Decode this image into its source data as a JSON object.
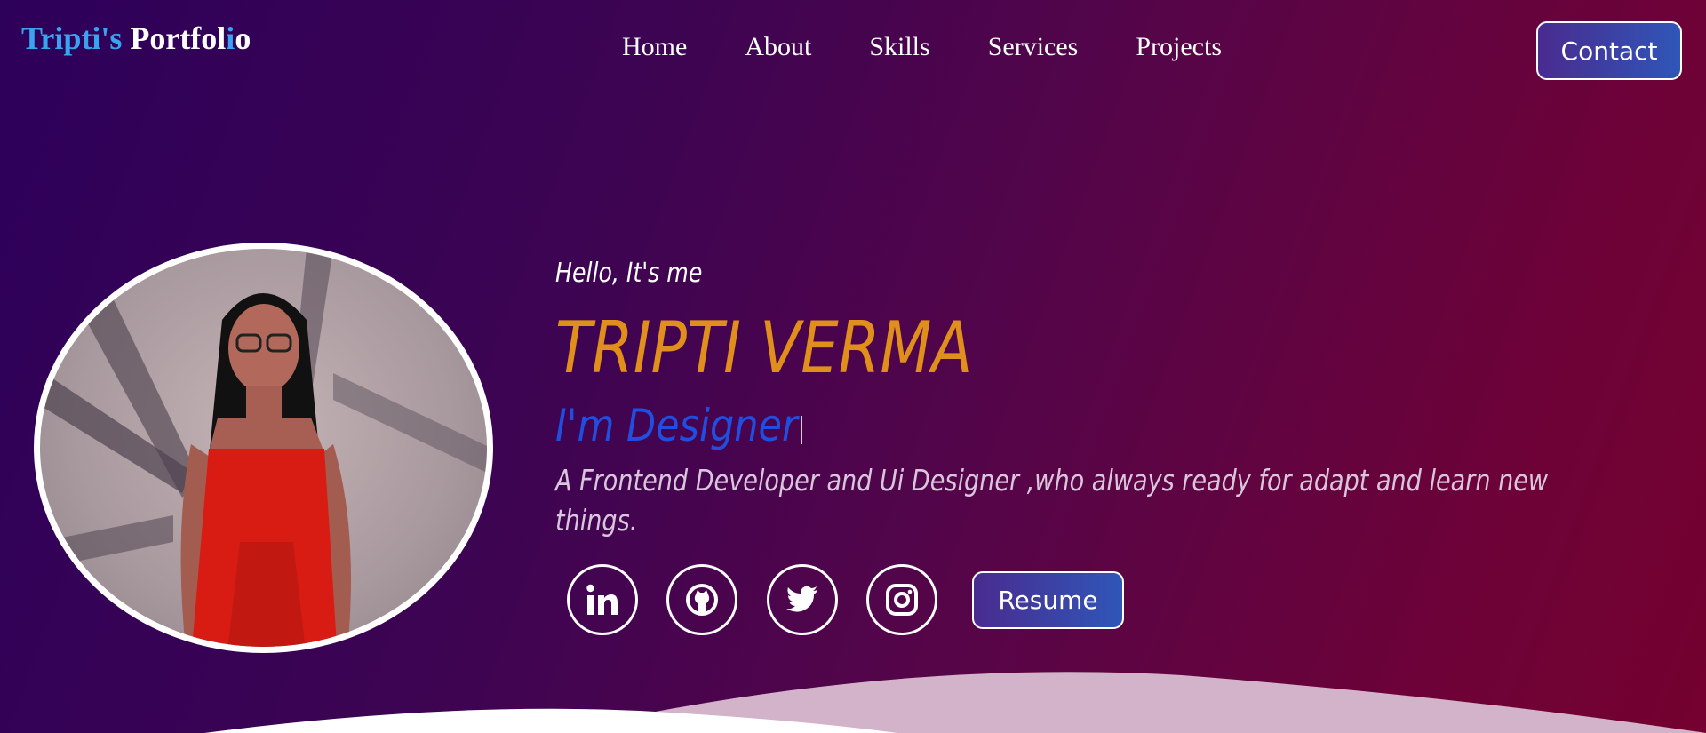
{
  "header": {
    "logo_part1": "Tripti's",
    "logo_part2": "Portfol",
    "logo_part3": "i",
    "logo_part4": "o",
    "nav": [
      "Home",
      "About",
      "Skills",
      "Services",
      "Projects"
    ],
    "contact_label": "Contact"
  },
  "hero": {
    "greeting": "Hello, It's me",
    "name": "TRIPTI VERMA",
    "role": "I'm Designer",
    "description": "A Frontend Developer and Ui Designer ,who always ready for adapt and learn new things.",
    "resume_label": "Resume",
    "socials": [
      "linkedin-icon",
      "github-icon",
      "twitter-icon",
      "instagram-icon"
    ]
  },
  "colors": {
    "accent_orange": "#e08f1c",
    "accent_blue": "#1f4ee0",
    "logo_blue": "#3aa3f0",
    "button_gradient": [
      "#4a2b8f",
      "#2f56b8"
    ]
  }
}
